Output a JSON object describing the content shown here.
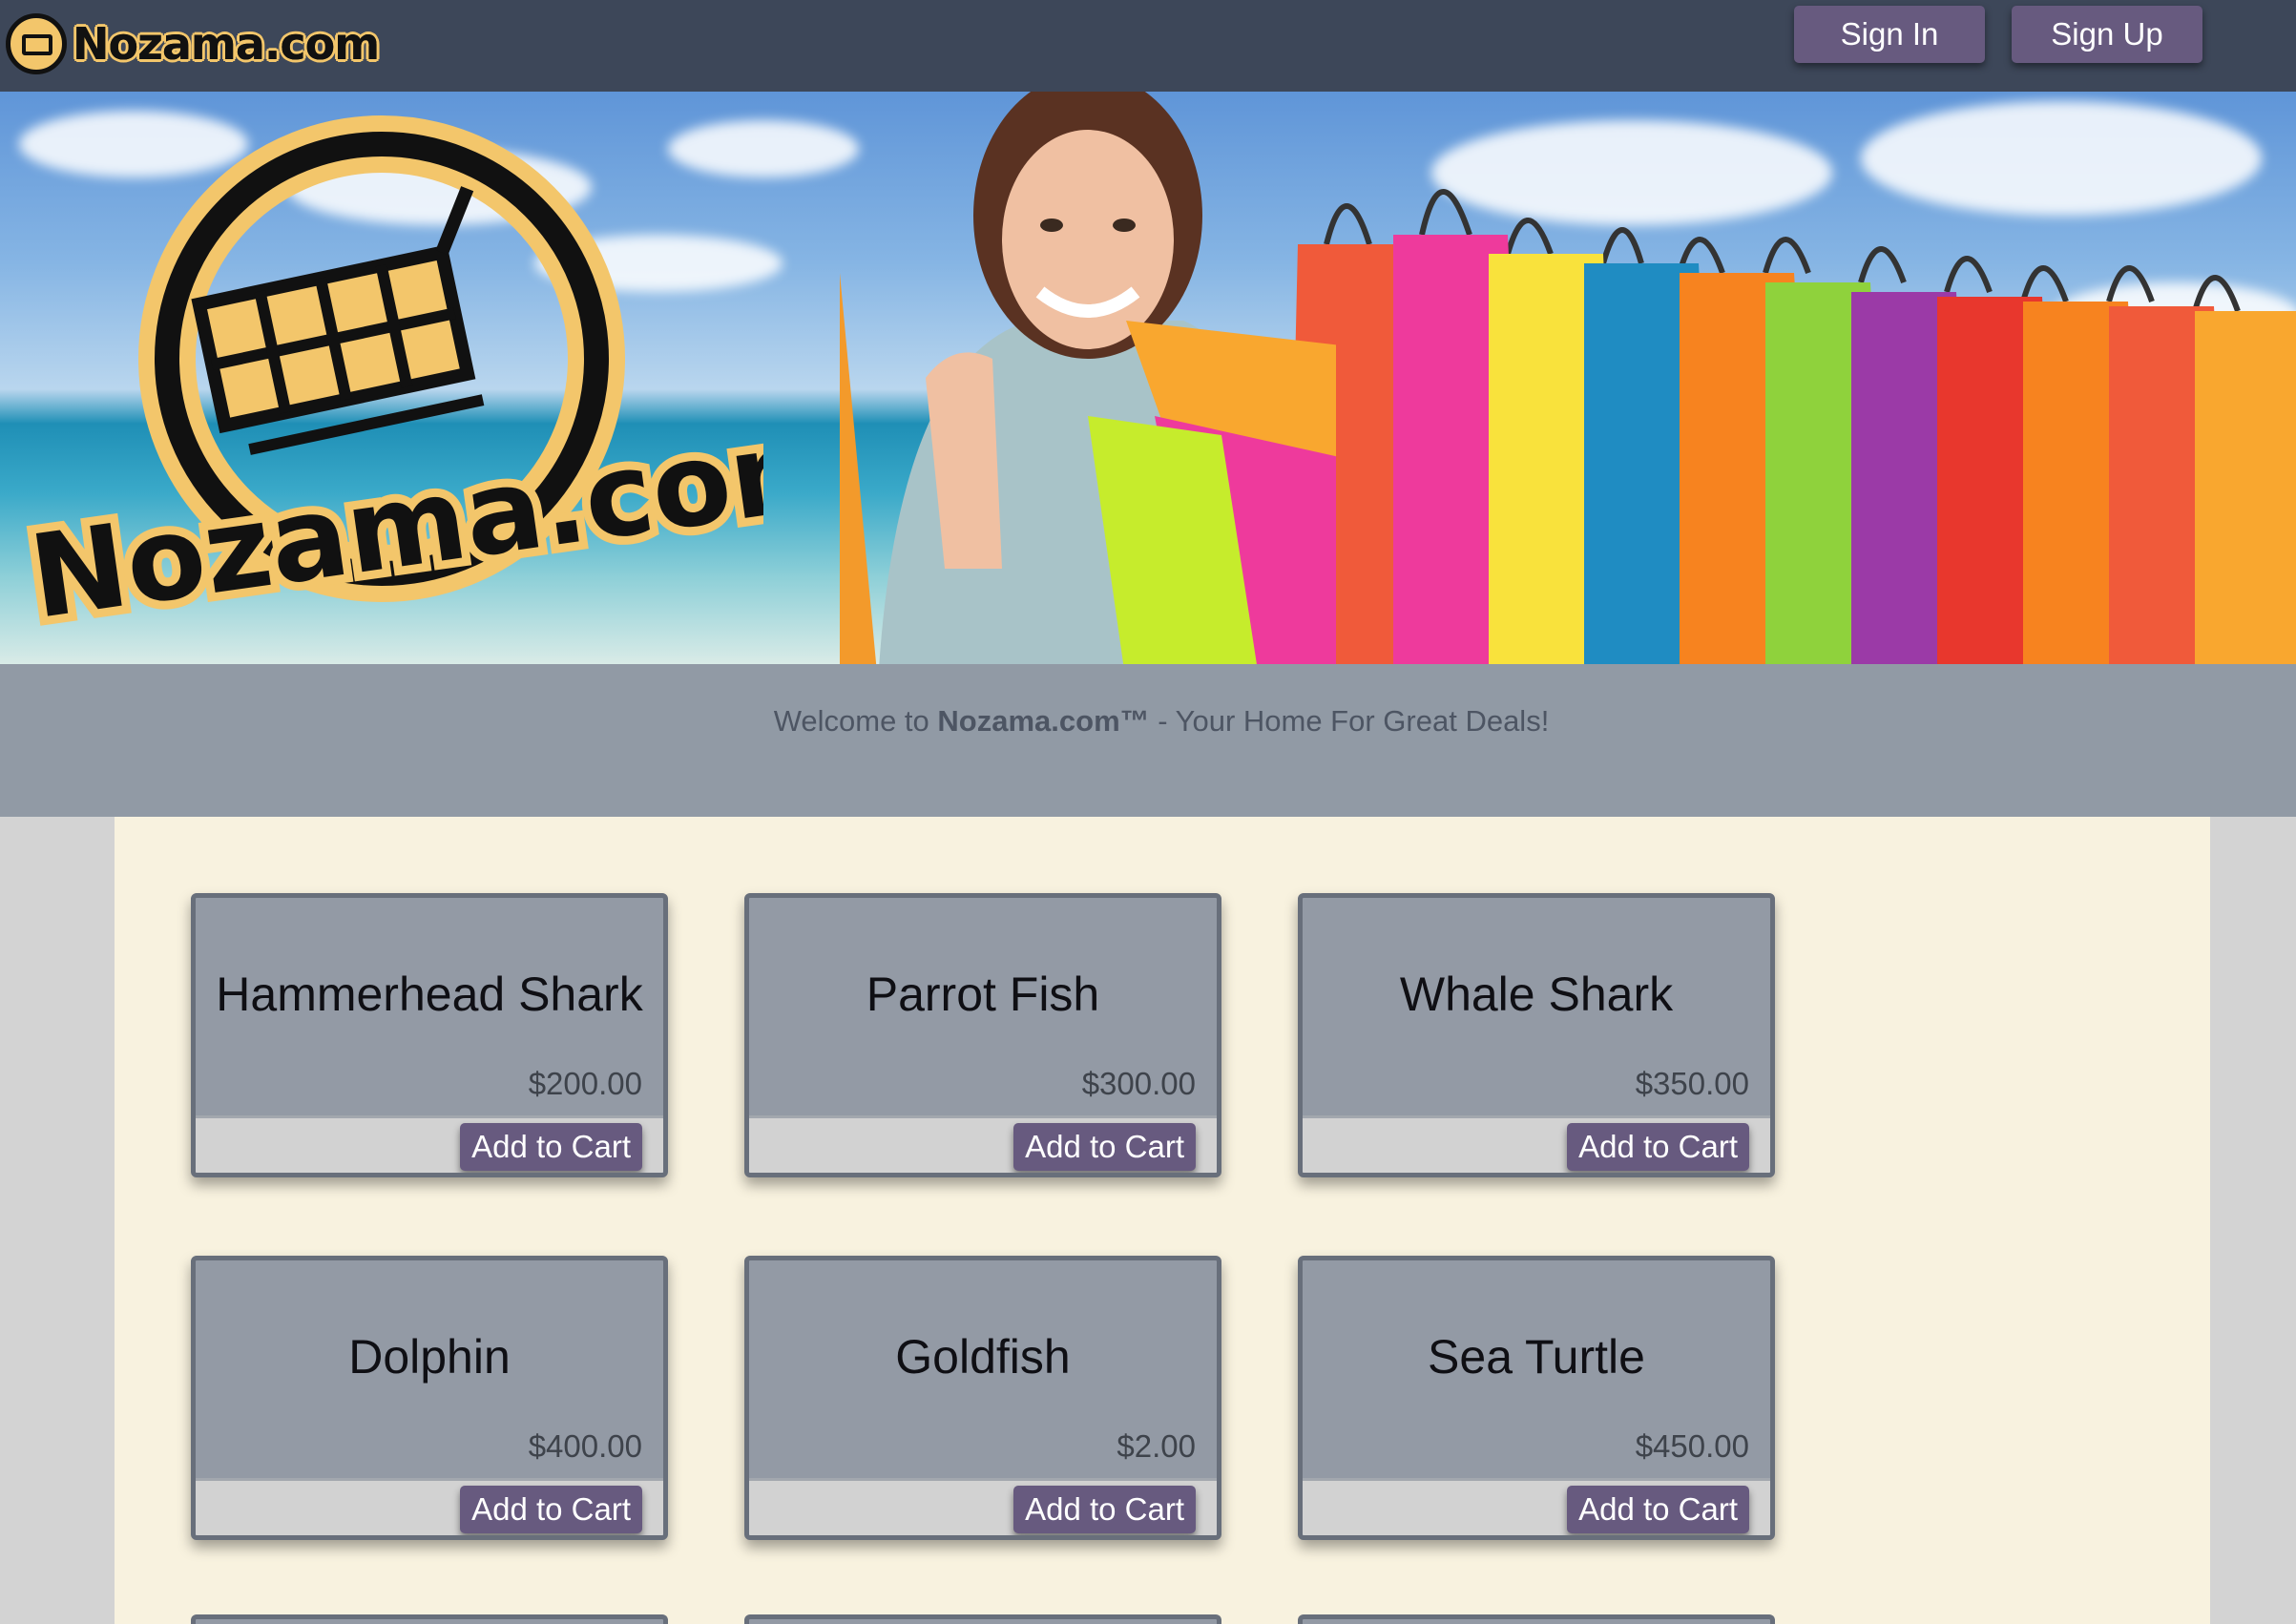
{
  "header": {
    "brand": "Nozama.com",
    "sign_in_label": "Sign In",
    "sign_up_label": "Sign Up"
  },
  "hero": {
    "logo_text": "Nozama.com"
  },
  "welcome": {
    "prefix": "Welcome to ",
    "brand": "Nozama.com™",
    "suffix": " - Your Home For Great Deals!"
  },
  "products": [
    {
      "name": "Hammerhead Shark",
      "price": "$200.00",
      "button": "Add to Cart"
    },
    {
      "name": "Parrot Fish",
      "price": "$300.00",
      "button": "Add to Cart"
    },
    {
      "name": "Whale Shark",
      "price": "$350.00",
      "button": "Add to Cart"
    },
    {
      "name": "Dolphin",
      "price": "$400.00",
      "button": "Add to Cart"
    },
    {
      "name": "Goldfish",
      "price": "$2.00",
      "button": "Add to Cart"
    },
    {
      "name": "Sea Turtle",
      "price": "$450.00",
      "button": "Add to Cart"
    }
  ],
  "colors": {
    "navbar": "#3d4759",
    "button": "#675a7f",
    "card": "#939aa5",
    "main_bg": "#f8f2df",
    "welcome_bg": "#919aa5",
    "brand_gold": "#f3c66b"
  }
}
